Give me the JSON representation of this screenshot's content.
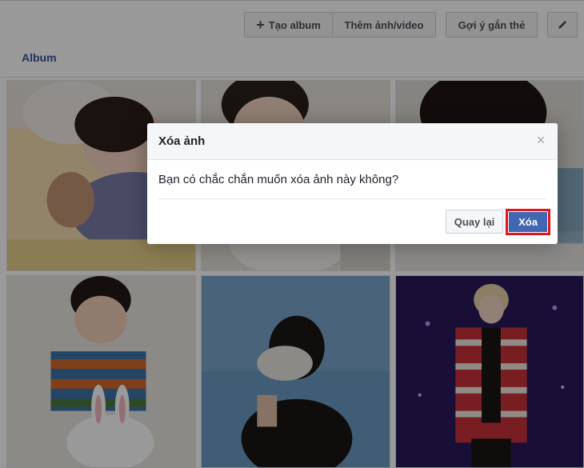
{
  "toolbar": {
    "create_album": "Tạo album",
    "add_photos": "Thêm ảnh/video",
    "suggest_tags": "Gợi ý gắn thẻ"
  },
  "tabs": {
    "album": "Album"
  },
  "photos": [
    {
      "icon": "sleeping-child-photo"
    },
    {
      "icon": "child-portrait-photo"
    },
    {
      "icon": "child-hair-photo"
    },
    {
      "icon": "toddler-striped-sweater-photo"
    },
    {
      "icon": "person-covering-face-photo"
    },
    {
      "icon": "performer-on-stage-photo"
    }
  ],
  "dialog": {
    "title": "Xóa ảnh",
    "message": "Bạn có chắc chắn muốn xóa ảnh này không?",
    "cancel_label": "Quay lại",
    "confirm_label": "Xóa"
  },
  "colors": {
    "primary": "#4267b2",
    "highlight": "#e0161e",
    "link": "#365899"
  }
}
